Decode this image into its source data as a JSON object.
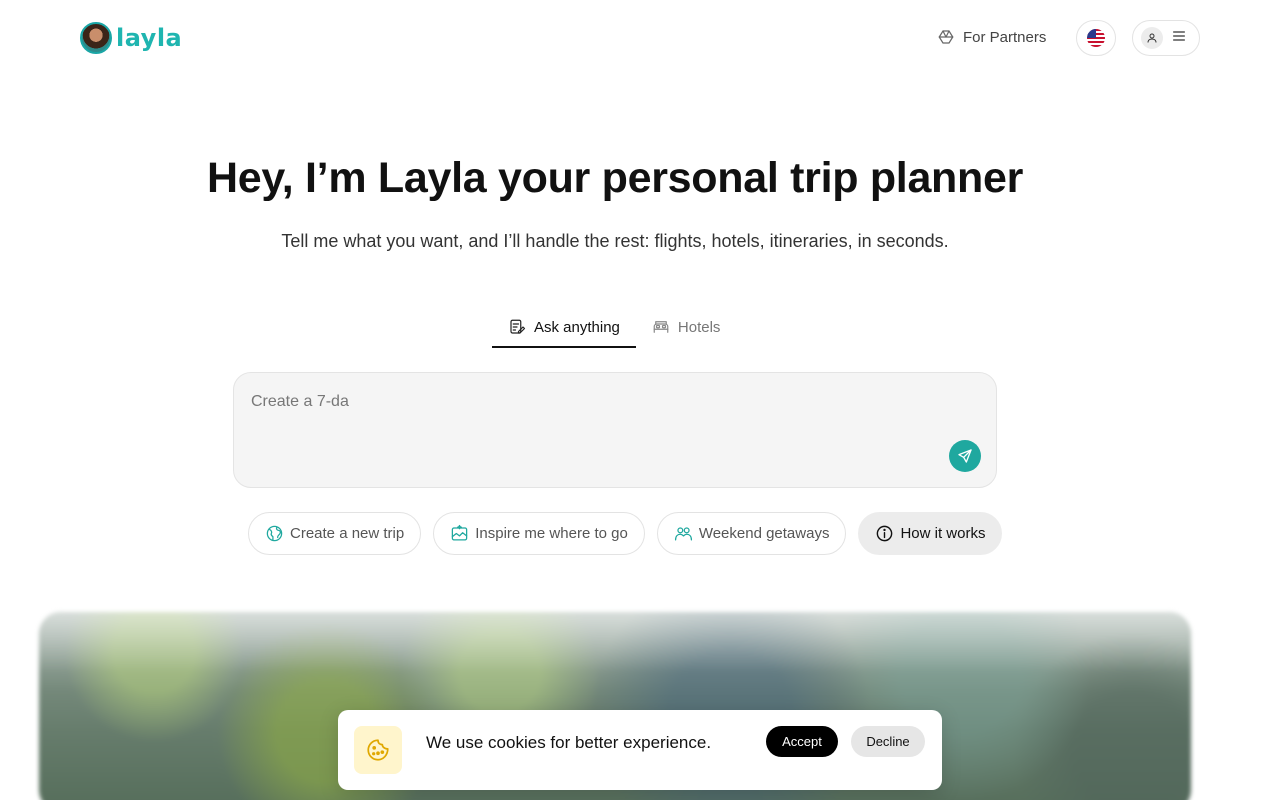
{
  "brand": {
    "name": "layla",
    "accent": "#1fb5b0"
  },
  "header": {
    "partners_label": "For Partners",
    "language_flag": "us-flag-icon"
  },
  "hero": {
    "title": "Hey, I’m Layla your personal trip planner",
    "subtitle": "Tell me what you want, and I’ll handle the rest: flights, hotels, itineraries, in seconds."
  },
  "tabs": [
    {
      "label": "Ask anything",
      "icon": "edit-note-icon",
      "active": true
    },
    {
      "label": "Hotels",
      "icon": "bed-icon",
      "active": false
    }
  ],
  "prompt": {
    "typed_text": "Create a 7-da",
    "send_color": "#1fa89f"
  },
  "chips": [
    {
      "label": "Create a new trip",
      "icon": "globe-icon"
    },
    {
      "label": "Inspire me where to go",
      "icon": "sparkle-map-icon"
    },
    {
      "label": "Weekend getaways",
      "icon": "people-icon"
    },
    {
      "label": "How it works",
      "icon": "info-icon"
    }
  ],
  "cookie": {
    "message": "We use cookies for better experience.",
    "accept_label": "Accept",
    "decline_label": "Decline"
  }
}
